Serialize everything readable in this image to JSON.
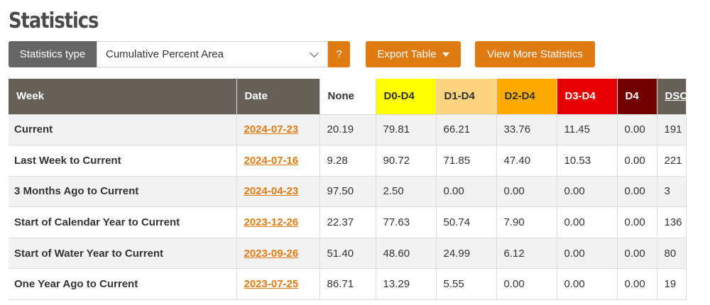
{
  "page": {
    "title": "Statistics"
  },
  "toolbar": {
    "type_label": "Statistics type",
    "type_value": "Cumulative Percent Area",
    "help_label": "?",
    "export_label": "Export Table",
    "more_label": "View More Statistics"
  },
  "table": {
    "headers": {
      "week": "Week",
      "date": "Date",
      "none": "None",
      "d0": "D0-D4",
      "d1": "D1-D4",
      "d2": "D2-D4",
      "d3": "D3-D4",
      "d4": "D4",
      "dsci": "DSCI"
    },
    "header_colors": {
      "d0": "#ffff00",
      "d1": "#fcd37f",
      "d2": "#ffaa00",
      "d3": "#e60000",
      "d4": "#730000"
    },
    "rows": [
      {
        "week": "Current",
        "date": "2024-07-23",
        "none": "20.19",
        "d0": "79.81",
        "d1": "66.21",
        "d2": "33.76",
        "d3": "11.45",
        "d4": "0.00",
        "dsci": "191"
      },
      {
        "week": "Last Week to Current",
        "date": "2024-07-16",
        "none": "9.28",
        "d0": "90.72",
        "d1": "71.85",
        "d2": "47.40",
        "d3": "10.53",
        "d4": "0.00",
        "dsci": "221"
      },
      {
        "week": "3 Months Ago to Current",
        "date": "2024-04-23",
        "none": "97.50",
        "d0": "2.50",
        "d1": "0.00",
        "d2": "0.00",
        "d3": "0.00",
        "d4": "0.00",
        "dsci": "3"
      },
      {
        "week": "Start of Calendar Year to Current",
        "date": "2023-12-26",
        "none": "22.37",
        "d0": "77.63",
        "d1": "50.74",
        "d2": "7.90",
        "d3": "0.00",
        "d4": "0.00",
        "dsci": "136"
      },
      {
        "week": "Start of Water Year to Current",
        "date": "2023-09-26",
        "none": "51.40",
        "d0": "48.60",
        "d1": "24.99",
        "d2": "6.12",
        "d3": "0.00",
        "d4": "0.00",
        "dsci": "80"
      },
      {
        "week": "One Year Ago to Current",
        "date": "2023-07-25",
        "none": "86.71",
        "d0": "13.29",
        "d1": "5.55",
        "d2": "0.00",
        "d3": "0.00",
        "d4": "0.00",
        "dsci": "19"
      }
    ]
  }
}
